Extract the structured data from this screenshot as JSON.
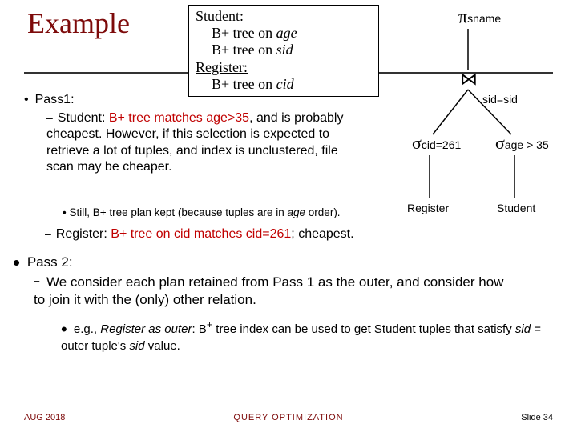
{
  "title": "Example",
  "indexbox": {
    "student_hd": "Student:",
    "student_age": "B+ tree on",
    "student_age_i": "age",
    "student_sid": "B+ tree on",
    "student_sid_i": "sid",
    "register_hd": "Register:",
    "register_cid": "B+ tree on",
    "register_cid_i": "cid"
  },
  "pass1_label": "Pass1:",
  "student_bullet_pre": "Student:  ",
  "student_bullet_red": "B+ tree matches age>35",
  "student_bullet_tail": ", and is probably cheapest.  However, if this selection is expected to retrieve a lot of tuples, and index is unclustered, file scan may be cheaper.",
  "still_note_pre": "•  Still, B+ tree plan kept (because tuples are in ",
  "still_note_i": "age",
  "still_note_post": " order).",
  "register_bullet_pre": "Register:  ",
  "register_bullet_red": "B+ tree on cid matches cid=261",
  "register_bullet_post": "; cheapest.",
  "pass2_label": "Pass 2:",
  "pass2_sub": "We consider each plan retained from Pass 1 as the outer, and consider how to join it with the (only) other relation.",
  "pass2_note_pre": "e.g., ",
  "pass2_note_i1": "Register as outer",
  "pass2_note_mid": ":  B",
  "pass2_note_sup": "+",
  "pass2_note_mid2": " tree index can be used to get Student tuples that satisfy ",
  "pass2_note_i2": "sid",
  "pass2_note_mid3": " = outer tuple's ",
  "pass2_note_i3": "sid",
  "pass2_note_end": " value.",
  "qt": {
    "proj": "sname",
    "join_cond": "sid=sid",
    "sel_r": "cid=261",
    "sel_s": "age > 35",
    "leaf_r": "Register",
    "leaf_s": "Student"
  },
  "footer": {
    "left": "AUG  2018",
    "center": "QUERY  OPTIMIZATION",
    "right": "Slide 34"
  }
}
